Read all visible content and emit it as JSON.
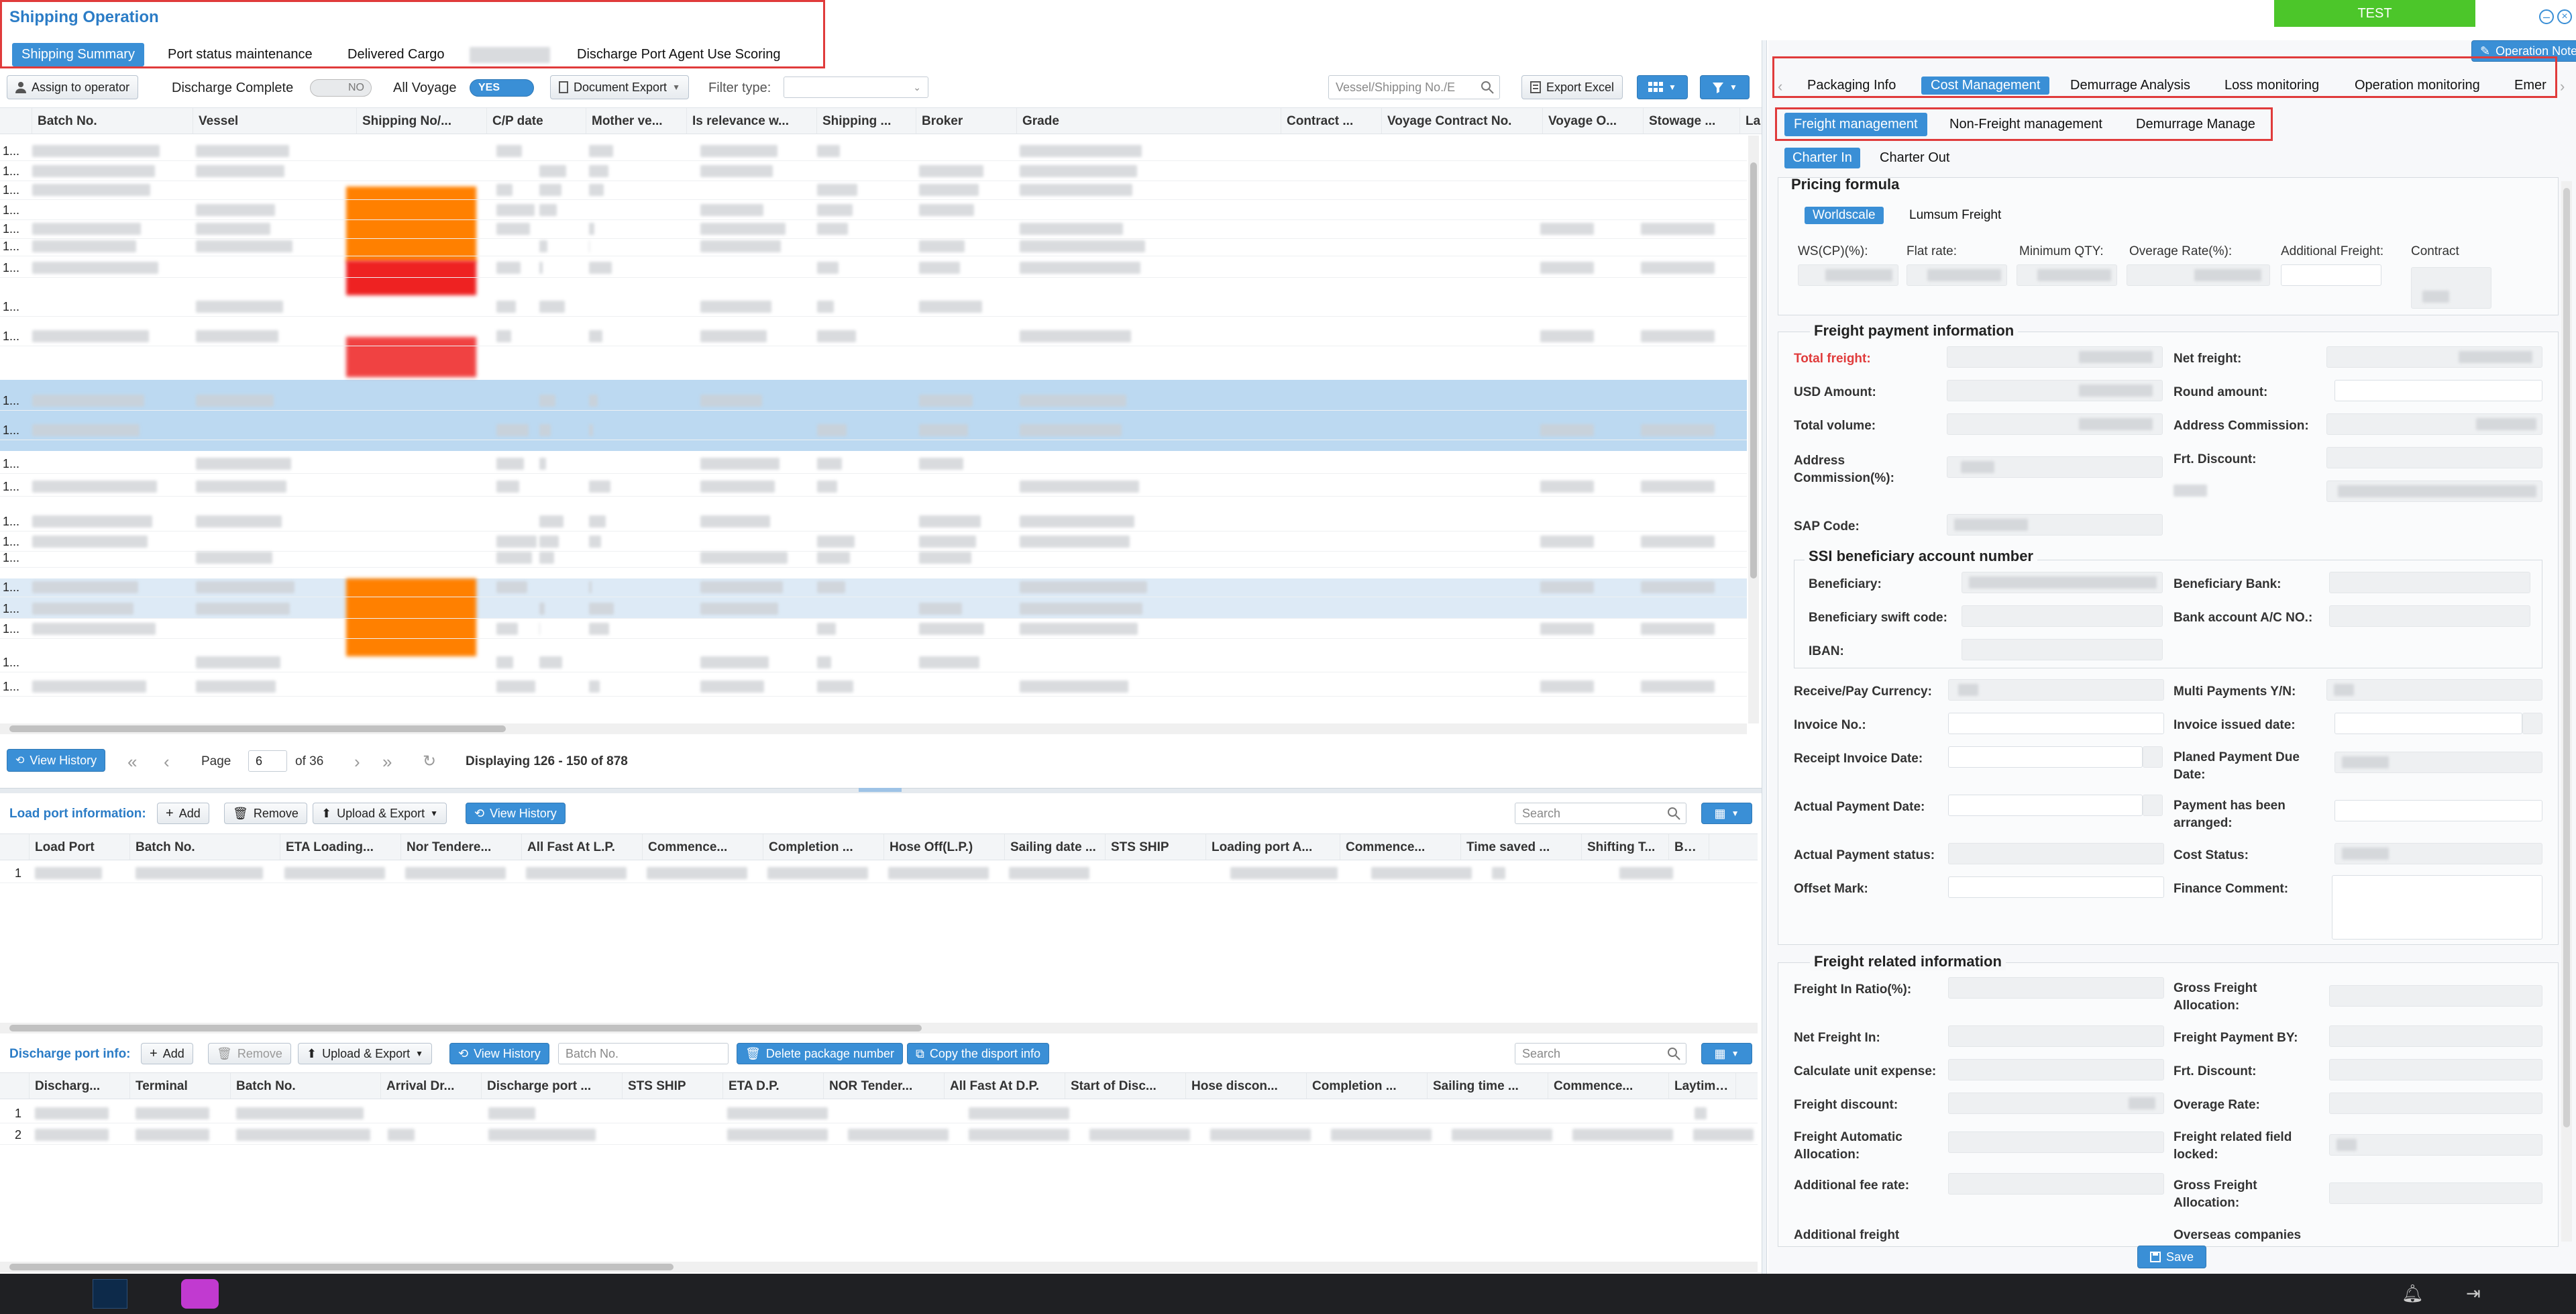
{
  "window": {
    "title": "Shipping Operation",
    "test_label": "TEST",
    "operation_note": "Operation Note"
  },
  "top_tabs": [
    "Shipping Summary",
    "Port status maintenance",
    "Delivered Cargo",
    "Discharge Port Agent Use Scoring"
  ],
  "toolbar": {
    "assign": "Assign to operator",
    "discharge_complete": "Discharge Complete",
    "toggle_no": "NO",
    "all_voyage": "All Voyage",
    "toggle_yes": "YES",
    "document_export": "Document Export",
    "filter_type": "Filter type:",
    "vessel_search_placeholder": "Vessel/Shipping No./E",
    "export_excel": "Export Excel"
  },
  "main_grid": {
    "columns": [
      "Batch No.",
      "Vessel",
      "Shipping No/...",
      "C/P date",
      "Mother ve...",
      "Is relevance w...",
      "Shipping ...",
      "Broker",
      "Grade",
      "Contract ...",
      "Voyage Contract No.",
      "Voyage O...",
      "Stowage ...",
      "La"
    ],
    "row_prefix": "1..."
  },
  "pager": {
    "view_history": "View History",
    "page_label": "Page",
    "page": "6",
    "of_label": "of 36",
    "displaying": "Displaying 126 - 150 of 878"
  },
  "load_port": {
    "title": "Load port information:",
    "add": "Add",
    "remove": "Remove",
    "upload_export": "Upload & Export",
    "view_history": "View History",
    "search_placeholder": "Search",
    "columns": [
      "Load Port",
      "Batch No.",
      "ETA Loading...",
      "Nor Tendere...",
      "All Fast At L.P.",
      "Commence...",
      "Completion ...",
      "Hose Off(L.P.)",
      "Sailing date ...",
      "STS SHIP",
      "Loading port A...",
      "Commence...",
      "Time saved ...",
      "Shifting T...",
      "Bad W"
    ],
    "rows": [
      "1"
    ]
  },
  "discharge_port": {
    "title": "Discharge port info:",
    "add": "Add",
    "remove": "Remove",
    "upload_export": "Upload & Export",
    "view_history": "View History",
    "batch_placeholder": "Batch No.",
    "delete_package": "Delete package number",
    "copy_disport": "Copy the disport info",
    "search_placeholder": "Search",
    "columns": [
      "Discharg...",
      "Terminal",
      "Batch No.",
      "Arrival Dr...",
      "Discharge port ...",
      "STS SHIP",
      "ETA D.P.",
      "NOR Tender...",
      "All Fast At D.P.",
      "Start of Disc...",
      "Hose discon...",
      "Completion ...",
      "Sailing time ...",
      "Commence...",
      "Laytime u"
    ],
    "rows": [
      "1",
      "2"
    ]
  },
  "right_panel": {
    "tabs": [
      "Packaging Info",
      "Cost Management",
      "Demurrage Analysis",
      "Loss monitoring",
      "Operation monitoring",
      "Emer"
    ],
    "sub_tabs": [
      "Freight management",
      "Non-Freight management",
      "Demurrage Manage"
    ],
    "charter_tabs": [
      "Charter In",
      "Charter Out"
    ],
    "pricing": {
      "title": "Pricing formula",
      "options": [
        "Worldscale",
        "Lumsum Freight"
      ],
      "labels": [
        "WS(CP)(%):",
        "Flat rate:",
        "Minimum QTY:",
        "Overage Rate(%):",
        "Additional Freight:",
        "Contract"
      ]
    },
    "payment": {
      "title": "Freight payment information",
      "left": [
        "Total freight:",
        "USD Amount:",
        "Total volume:",
        "Address Commission(%):",
        "SAP Code:"
      ],
      "right": [
        "Net freight:",
        "Round amount:",
        "Address Commission:",
        "Frt. Discount:"
      ]
    },
    "ssi": {
      "title": "SSI beneficiary account number",
      "left": [
        "Beneficiary:",
        "Beneficiary swift code:",
        "IBAN:"
      ],
      "right": [
        "Beneficiary Bank:",
        "Bank account A/C NO.:"
      ]
    },
    "invoice": {
      "left": [
        "Receive/Pay Currency:",
        "Invoice No.:",
        "Receipt Invoice Date:",
        "Actual Payment Date:",
        "Actual Payment status:",
        "Offset Mark:"
      ],
      "right": [
        "Multi Payments Y/N:",
        "Invoice issued date:",
        "Planed Payment Due Date:",
        "Payment has been arranged:",
        "Cost Status:",
        "Finance Comment:"
      ]
    },
    "related": {
      "title": "Freight related information",
      "left": [
        "Freight In Ratio(%):",
        "Net Freight In:",
        "Calculate unit expense:",
        "Freight discount:",
        "Freight Automatic Allocation:",
        "Additional fee rate:",
        "Additional freight"
      ],
      "right": [
        "Gross Freight Allocation:",
        "Freight Payment BY:",
        "Frt. Discount:",
        "Overage Rate:",
        "Freight related field locked:",
        "Gross Freight Allocation:",
        "Overseas companies"
      ]
    },
    "save": "Save"
  },
  "colors": {
    "accent": "#3a8fd6",
    "test_green": "#4cc62a",
    "total_freight_red": "#e03b3b",
    "highlight_orange": "#ff8000",
    "highlight_red": "#ee2222",
    "selected_row": "#bcd9f1"
  }
}
